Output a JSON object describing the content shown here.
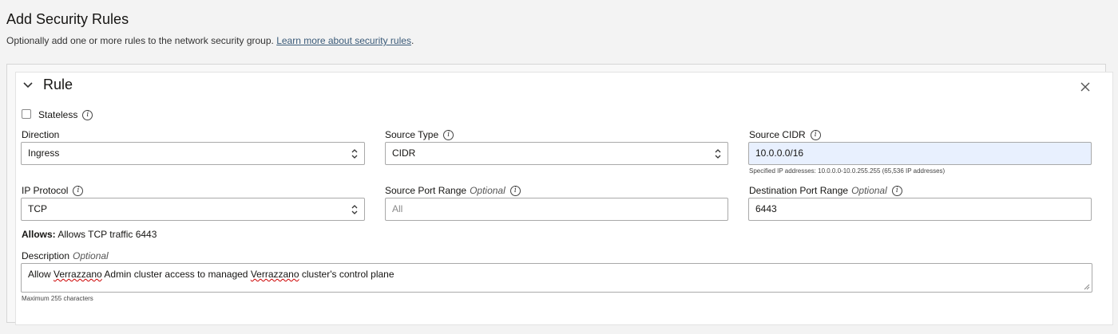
{
  "page": {
    "title": "Add Security Rules",
    "subtitle_prefix": "Optionally add one or more rules to the network security group. ",
    "subtitle_link": "Learn more about security rules",
    "subtitle_suffix": "."
  },
  "rule": {
    "title": "Rule",
    "stateless_label": "Stateless",
    "stateless_checked": false,
    "direction": {
      "label": "Direction",
      "value": "Ingress"
    },
    "source_type": {
      "label": "Source Type",
      "value": "CIDR"
    },
    "source_cidr": {
      "label": "Source CIDR",
      "value": "10.0.0.0/16",
      "hint": "Specified IP addresses: 10.0.0.0-10.0.255.255 (65,536 IP addresses)"
    },
    "ip_protocol": {
      "label": "IP Protocol",
      "value": "TCP"
    },
    "source_port_range": {
      "label": "Source Port Range",
      "optional": "Optional",
      "placeholder": "All"
    },
    "destination_port_range": {
      "label": "Destination Port Range",
      "optional": "Optional",
      "value": "6443"
    },
    "allows": {
      "label": "Allows:",
      "text": "Allows TCP traffic 6443"
    },
    "description": {
      "label": "Description",
      "optional": "Optional",
      "value_parts": [
        "Allow ",
        "Verrazzano",
        " Admin cluster access to managed ",
        "Verrazzano",
        " cluster's control plane"
      ],
      "hint": "Maximum 255 characters"
    }
  },
  "icons": {
    "collapse": "chevron-down-icon",
    "close": "close-icon",
    "info": "info-icon",
    "select": "select-arrows-icon"
  },
  "colors": {
    "link": "#3a5a78",
    "highlight_field": "#e8f0fe"
  }
}
